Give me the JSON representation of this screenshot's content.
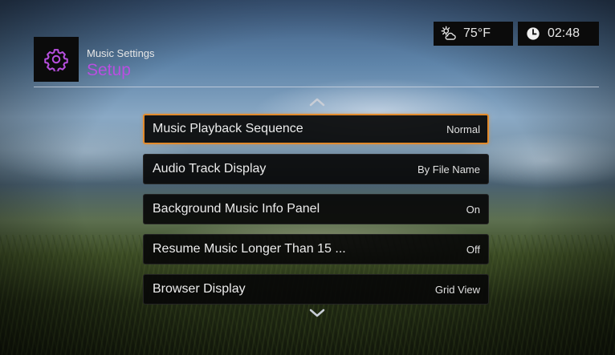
{
  "header": {
    "subtitle": "Music Settings",
    "title": "Setup",
    "icon": "gear-icon",
    "accent_color": "#b84fe0"
  },
  "status": {
    "weather_icon": "partly-cloudy-icon",
    "temperature": "75°F",
    "clock_icon": "clock-icon",
    "time": "02:48"
  },
  "menu": {
    "selection_color": "#e18a2c",
    "items": [
      {
        "label": "Music Playback Sequence",
        "value": "Normal",
        "selected": true
      },
      {
        "label": "Audio Track Display",
        "value": "By File Name",
        "selected": false
      },
      {
        "label": "Background Music Info Panel",
        "value": "On",
        "selected": false
      },
      {
        "label": "Resume Music Longer Than 15 ...",
        "value": "Off",
        "selected": false
      },
      {
        "label": "Browser Display",
        "value": "Grid View",
        "selected": false
      }
    ]
  }
}
